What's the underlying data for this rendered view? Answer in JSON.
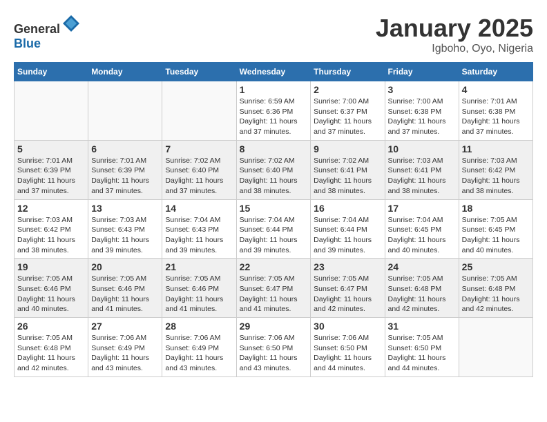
{
  "header": {
    "logo_general": "General",
    "logo_blue": "Blue",
    "month_title": "January 2025",
    "location": "Igboho, Oyo, Nigeria"
  },
  "days_of_week": [
    "Sunday",
    "Monday",
    "Tuesday",
    "Wednesday",
    "Thursday",
    "Friday",
    "Saturday"
  ],
  "weeks": [
    [
      {
        "num": "",
        "sunrise": "",
        "sunset": "",
        "daylight": ""
      },
      {
        "num": "",
        "sunrise": "",
        "sunset": "",
        "daylight": ""
      },
      {
        "num": "",
        "sunrise": "",
        "sunset": "",
        "daylight": ""
      },
      {
        "num": "1",
        "sunrise": "Sunrise: 6:59 AM",
        "sunset": "Sunset: 6:36 PM",
        "daylight": "Daylight: 11 hours and 37 minutes."
      },
      {
        "num": "2",
        "sunrise": "Sunrise: 7:00 AM",
        "sunset": "Sunset: 6:37 PM",
        "daylight": "Daylight: 11 hours and 37 minutes."
      },
      {
        "num": "3",
        "sunrise": "Sunrise: 7:00 AM",
        "sunset": "Sunset: 6:38 PM",
        "daylight": "Daylight: 11 hours and 37 minutes."
      },
      {
        "num": "4",
        "sunrise": "Sunrise: 7:01 AM",
        "sunset": "Sunset: 6:38 PM",
        "daylight": "Daylight: 11 hours and 37 minutes."
      }
    ],
    [
      {
        "num": "5",
        "sunrise": "Sunrise: 7:01 AM",
        "sunset": "Sunset: 6:39 PM",
        "daylight": "Daylight: 11 hours and 37 minutes."
      },
      {
        "num": "6",
        "sunrise": "Sunrise: 7:01 AM",
        "sunset": "Sunset: 6:39 PM",
        "daylight": "Daylight: 11 hours and 37 minutes."
      },
      {
        "num": "7",
        "sunrise": "Sunrise: 7:02 AM",
        "sunset": "Sunset: 6:40 PM",
        "daylight": "Daylight: 11 hours and 37 minutes."
      },
      {
        "num": "8",
        "sunrise": "Sunrise: 7:02 AM",
        "sunset": "Sunset: 6:40 PM",
        "daylight": "Daylight: 11 hours and 38 minutes."
      },
      {
        "num": "9",
        "sunrise": "Sunrise: 7:02 AM",
        "sunset": "Sunset: 6:41 PM",
        "daylight": "Daylight: 11 hours and 38 minutes."
      },
      {
        "num": "10",
        "sunrise": "Sunrise: 7:03 AM",
        "sunset": "Sunset: 6:41 PM",
        "daylight": "Daylight: 11 hours and 38 minutes."
      },
      {
        "num": "11",
        "sunrise": "Sunrise: 7:03 AM",
        "sunset": "Sunset: 6:42 PM",
        "daylight": "Daylight: 11 hours and 38 minutes."
      }
    ],
    [
      {
        "num": "12",
        "sunrise": "Sunrise: 7:03 AM",
        "sunset": "Sunset: 6:42 PM",
        "daylight": "Daylight: 11 hours and 38 minutes."
      },
      {
        "num": "13",
        "sunrise": "Sunrise: 7:03 AM",
        "sunset": "Sunset: 6:43 PM",
        "daylight": "Daylight: 11 hours and 39 minutes."
      },
      {
        "num": "14",
        "sunrise": "Sunrise: 7:04 AM",
        "sunset": "Sunset: 6:43 PM",
        "daylight": "Daylight: 11 hours and 39 minutes."
      },
      {
        "num": "15",
        "sunrise": "Sunrise: 7:04 AM",
        "sunset": "Sunset: 6:44 PM",
        "daylight": "Daylight: 11 hours and 39 minutes."
      },
      {
        "num": "16",
        "sunrise": "Sunrise: 7:04 AM",
        "sunset": "Sunset: 6:44 PM",
        "daylight": "Daylight: 11 hours and 39 minutes."
      },
      {
        "num": "17",
        "sunrise": "Sunrise: 7:04 AM",
        "sunset": "Sunset: 6:45 PM",
        "daylight": "Daylight: 11 hours and 40 minutes."
      },
      {
        "num": "18",
        "sunrise": "Sunrise: 7:05 AM",
        "sunset": "Sunset: 6:45 PM",
        "daylight": "Daylight: 11 hours and 40 minutes."
      }
    ],
    [
      {
        "num": "19",
        "sunrise": "Sunrise: 7:05 AM",
        "sunset": "Sunset: 6:46 PM",
        "daylight": "Daylight: 11 hours and 40 minutes."
      },
      {
        "num": "20",
        "sunrise": "Sunrise: 7:05 AM",
        "sunset": "Sunset: 6:46 PM",
        "daylight": "Daylight: 11 hours and 41 minutes."
      },
      {
        "num": "21",
        "sunrise": "Sunrise: 7:05 AM",
        "sunset": "Sunset: 6:46 PM",
        "daylight": "Daylight: 11 hours and 41 minutes."
      },
      {
        "num": "22",
        "sunrise": "Sunrise: 7:05 AM",
        "sunset": "Sunset: 6:47 PM",
        "daylight": "Daylight: 11 hours and 41 minutes."
      },
      {
        "num": "23",
        "sunrise": "Sunrise: 7:05 AM",
        "sunset": "Sunset: 6:47 PM",
        "daylight": "Daylight: 11 hours and 42 minutes."
      },
      {
        "num": "24",
        "sunrise": "Sunrise: 7:05 AM",
        "sunset": "Sunset: 6:48 PM",
        "daylight": "Daylight: 11 hours and 42 minutes."
      },
      {
        "num": "25",
        "sunrise": "Sunrise: 7:05 AM",
        "sunset": "Sunset: 6:48 PM",
        "daylight": "Daylight: 11 hours and 42 minutes."
      }
    ],
    [
      {
        "num": "26",
        "sunrise": "Sunrise: 7:05 AM",
        "sunset": "Sunset: 6:48 PM",
        "daylight": "Daylight: 11 hours and 42 minutes."
      },
      {
        "num": "27",
        "sunrise": "Sunrise: 7:06 AM",
        "sunset": "Sunset: 6:49 PM",
        "daylight": "Daylight: 11 hours and 43 minutes."
      },
      {
        "num": "28",
        "sunrise": "Sunrise: 7:06 AM",
        "sunset": "Sunset: 6:49 PM",
        "daylight": "Daylight: 11 hours and 43 minutes."
      },
      {
        "num": "29",
        "sunrise": "Sunrise: 7:06 AM",
        "sunset": "Sunset: 6:50 PM",
        "daylight": "Daylight: 11 hours and 43 minutes."
      },
      {
        "num": "30",
        "sunrise": "Sunrise: 7:06 AM",
        "sunset": "Sunset: 6:50 PM",
        "daylight": "Daylight: 11 hours and 44 minutes."
      },
      {
        "num": "31",
        "sunrise": "Sunrise: 7:05 AM",
        "sunset": "Sunset: 6:50 PM",
        "daylight": "Daylight: 11 hours and 44 minutes."
      },
      {
        "num": "",
        "sunrise": "",
        "sunset": "",
        "daylight": ""
      }
    ]
  ]
}
